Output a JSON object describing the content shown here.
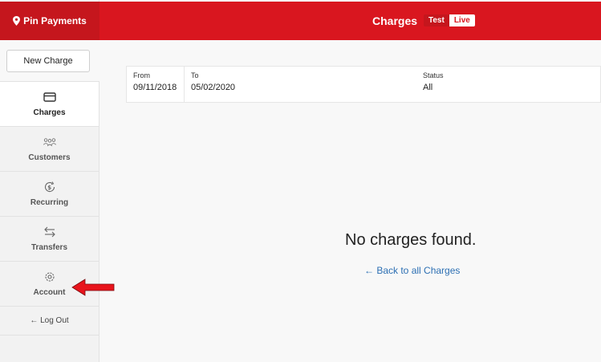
{
  "brand": {
    "name": "Pin Payments",
    "color": "#c5161d"
  },
  "header": {
    "title": "Charges",
    "mode_test": "Test",
    "mode_live": "Live"
  },
  "sidebar": {
    "new_charge": "New Charge",
    "items": [
      {
        "label": "Charges",
        "icon": "credit-card-icon",
        "active": true
      },
      {
        "label": "Customers",
        "icon": "users-icon",
        "active": false
      },
      {
        "label": "Recurring",
        "icon": "recurring-dollar-icon",
        "active": false
      },
      {
        "label": "Transfers",
        "icon": "transfer-arrows-icon",
        "active": false
      },
      {
        "label": "Account",
        "icon": "gear-icon",
        "active": false
      }
    ],
    "logout": "← Log Out"
  },
  "filter": {
    "from_label": "From",
    "from_value": "09/11/2018",
    "to_label": "To",
    "to_value": "05/02/2020",
    "status_label": "Status",
    "status_value": "All"
  },
  "main": {
    "empty_message": "No charges found.",
    "back_link": "← Back to all Charges"
  },
  "annotation": {
    "icon": "red-arrow-pointer",
    "color": "#e8141c"
  }
}
